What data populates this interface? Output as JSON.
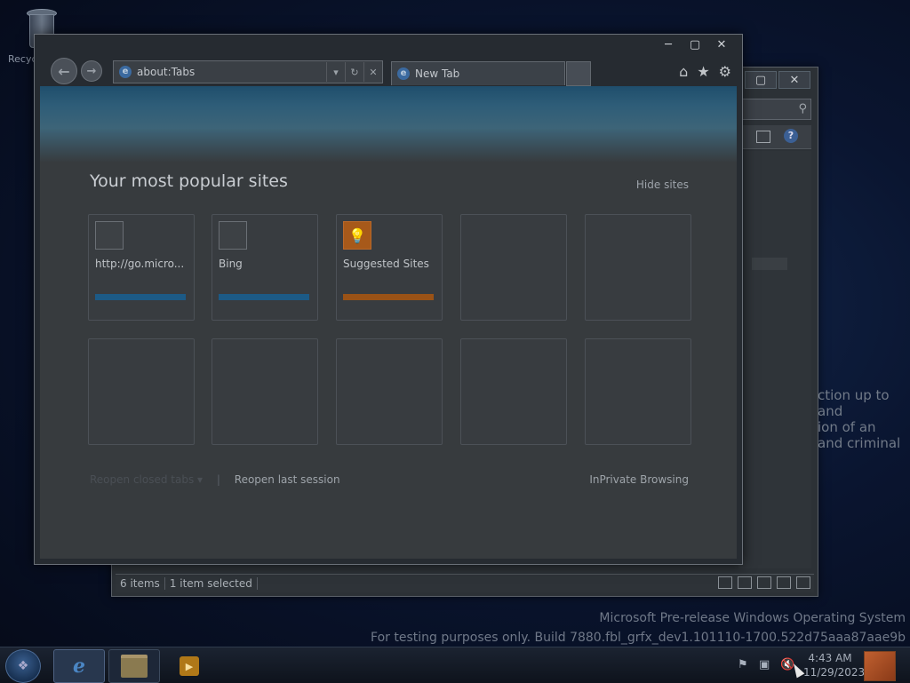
{
  "desktop": {
    "recycle_bin_label": "Recyc",
    "behind_text": [
      "ction up to and",
      "ion of an",
      "and criminal"
    ]
  },
  "explorer": {
    "status_items": "6 items",
    "status_selected": "1 item selected",
    "min": "─",
    "max": "▢",
    "close": "✕"
  },
  "ie": {
    "address": "about:Tabs",
    "tab_label": "New Tab",
    "caption": {
      "min": "─",
      "max": "▢",
      "close": "✕"
    },
    "new_tab_page": {
      "heading": "Your most popular sites",
      "hide_sites": "Hide sites",
      "tiles": [
        {
          "label": "http://go.micro...",
          "bar_color": "#1c5a86",
          "icon": "blank"
        },
        {
          "label": "Bing",
          "bar_color": "#1c5a86",
          "icon": "blank"
        },
        {
          "label": "Suggested Sites",
          "bar_color": "#9a5216",
          "icon": "lightbulb"
        }
      ],
      "reopen_closed_tabs": "Reopen closed tabs ▾",
      "reopen_last_session": "Reopen last session",
      "inprivate": "InPrivate Browsing"
    }
  },
  "watermark": {
    "line1": "Microsoft Pre-release Windows Operating System",
    "line2": "For testing purposes only. Build 7880.fbl_grfx_dev1.101110-1700.522d75aaa87aae9b"
  },
  "taskbar": {
    "time": "4:43 AM",
    "date": "11/29/2023"
  }
}
